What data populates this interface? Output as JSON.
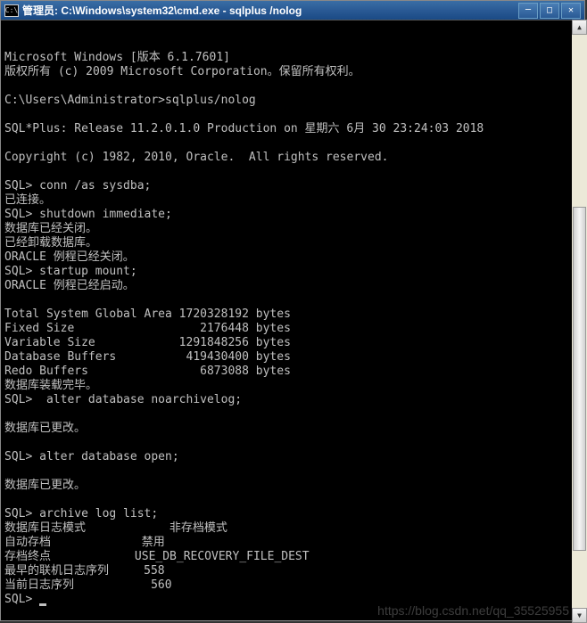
{
  "titlebar": {
    "icon_label": "cmd",
    "text": "管理员: C:\\Windows\\system32\\cmd.exe - sqlplus /nolog"
  },
  "terminal": {
    "lines": [
      "Microsoft Windows [版本 6.1.7601]",
      "版权所有 (c) 2009 Microsoft Corporation。保留所有权利。",
      "",
      "C:\\Users\\Administrator>sqlplus/nolog",
      "",
      "SQL*Plus: Release 11.2.0.1.0 Production on 星期六 6月 30 23:24:03 2018",
      "",
      "Copyright (c) 1982, 2010, Oracle.  All rights reserved.",
      "",
      "SQL> conn /as sysdba;",
      "已连接。",
      "SQL> shutdown immediate;",
      "数据库已经关闭。",
      "已经卸载数据库。",
      "ORACLE 例程已经关闭。",
      "SQL> startup mount;",
      "ORACLE 例程已经启动。",
      "",
      "Total System Global Area 1720328192 bytes",
      "Fixed Size                  2176448 bytes",
      "Variable Size            1291848256 bytes",
      "Database Buffers          419430400 bytes",
      "Redo Buffers                6873088 bytes",
      "数据库装载完毕。",
      "SQL>  alter database noarchivelog;",
      "",
      "数据库已更改。",
      "",
      "SQL> alter database open;",
      "",
      "数据库已更改。",
      "",
      "SQL> archive log list;",
      "数据库日志模式            非存档模式",
      "自动存档             禁用",
      "存档终点            USE_DB_RECOVERY_FILE_DEST",
      "最早的联机日志序列     558",
      "当前日志序列           560",
      "SQL> "
    ]
  },
  "watermark": "https://blog.csdn.net/qq_35525955"
}
